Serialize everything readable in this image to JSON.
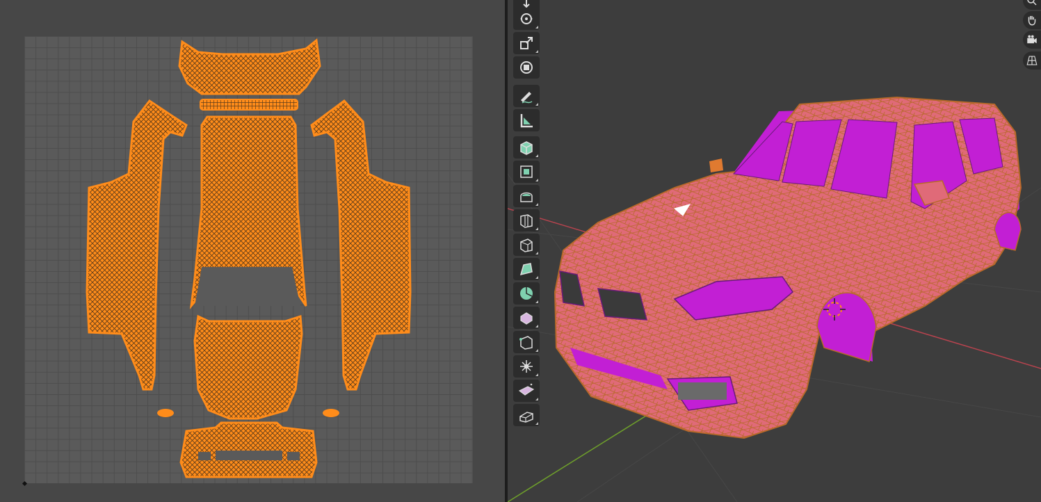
{
  "uv_editor": {
    "island_fill": "#ff8c1a",
    "island_wire": "#5a3a1a",
    "grid_background": "#5a5a5a"
  },
  "viewport": {
    "mesh_face_color": "#e06a78",
    "mesh_wire_color": "#b8692a",
    "interior_color": "#c21fd4",
    "axis_x_color": "#b8434e",
    "axis_y_color": "#6e9f2b",
    "background": "#3d3d3d"
  },
  "toolbar": {
    "tools": [
      {
        "name": "select-tool",
        "icon": "cursor-arrow-icon"
      },
      {
        "name": "rotate-tool",
        "icon": "rotate-icon"
      },
      {
        "name": "scale-tool",
        "icon": "scale-icon"
      },
      {
        "name": "transform-tool",
        "icon": "transform-icon"
      },
      {
        "name": "annotate-tool",
        "icon": "pencil-icon"
      },
      {
        "name": "measure-tool",
        "icon": "ruler-icon"
      },
      {
        "name": "add-cube-tool",
        "icon": "cube-add-icon"
      },
      {
        "name": "extrude-tool",
        "icon": "extrude-icon"
      },
      {
        "name": "inset-tool",
        "icon": "inset-icon"
      },
      {
        "name": "bevel-tool",
        "icon": "bevel-icon"
      },
      {
        "name": "loop-cut-tool",
        "icon": "loop-cut-icon"
      },
      {
        "name": "knife-tool",
        "icon": "knife-icon"
      },
      {
        "name": "poly-build-tool",
        "icon": "poly-build-icon"
      },
      {
        "name": "spin-tool",
        "icon": "spin-icon"
      },
      {
        "name": "smooth-tool",
        "icon": "smooth-icon"
      },
      {
        "name": "edge-slide-tool",
        "icon": "edge-slide-icon"
      },
      {
        "name": "shrink-fatten-tool",
        "icon": "shrink-fatten-icon"
      },
      {
        "name": "shear-tool",
        "icon": "shear-icon"
      },
      {
        "name": "rip-region-tool",
        "icon": "rip-icon"
      }
    ]
  },
  "navigation": {
    "buttons": [
      "zoom-icon",
      "pan-hand-icon",
      "camera-icon",
      "perspective-grid-icon"
    ]
  }
}
